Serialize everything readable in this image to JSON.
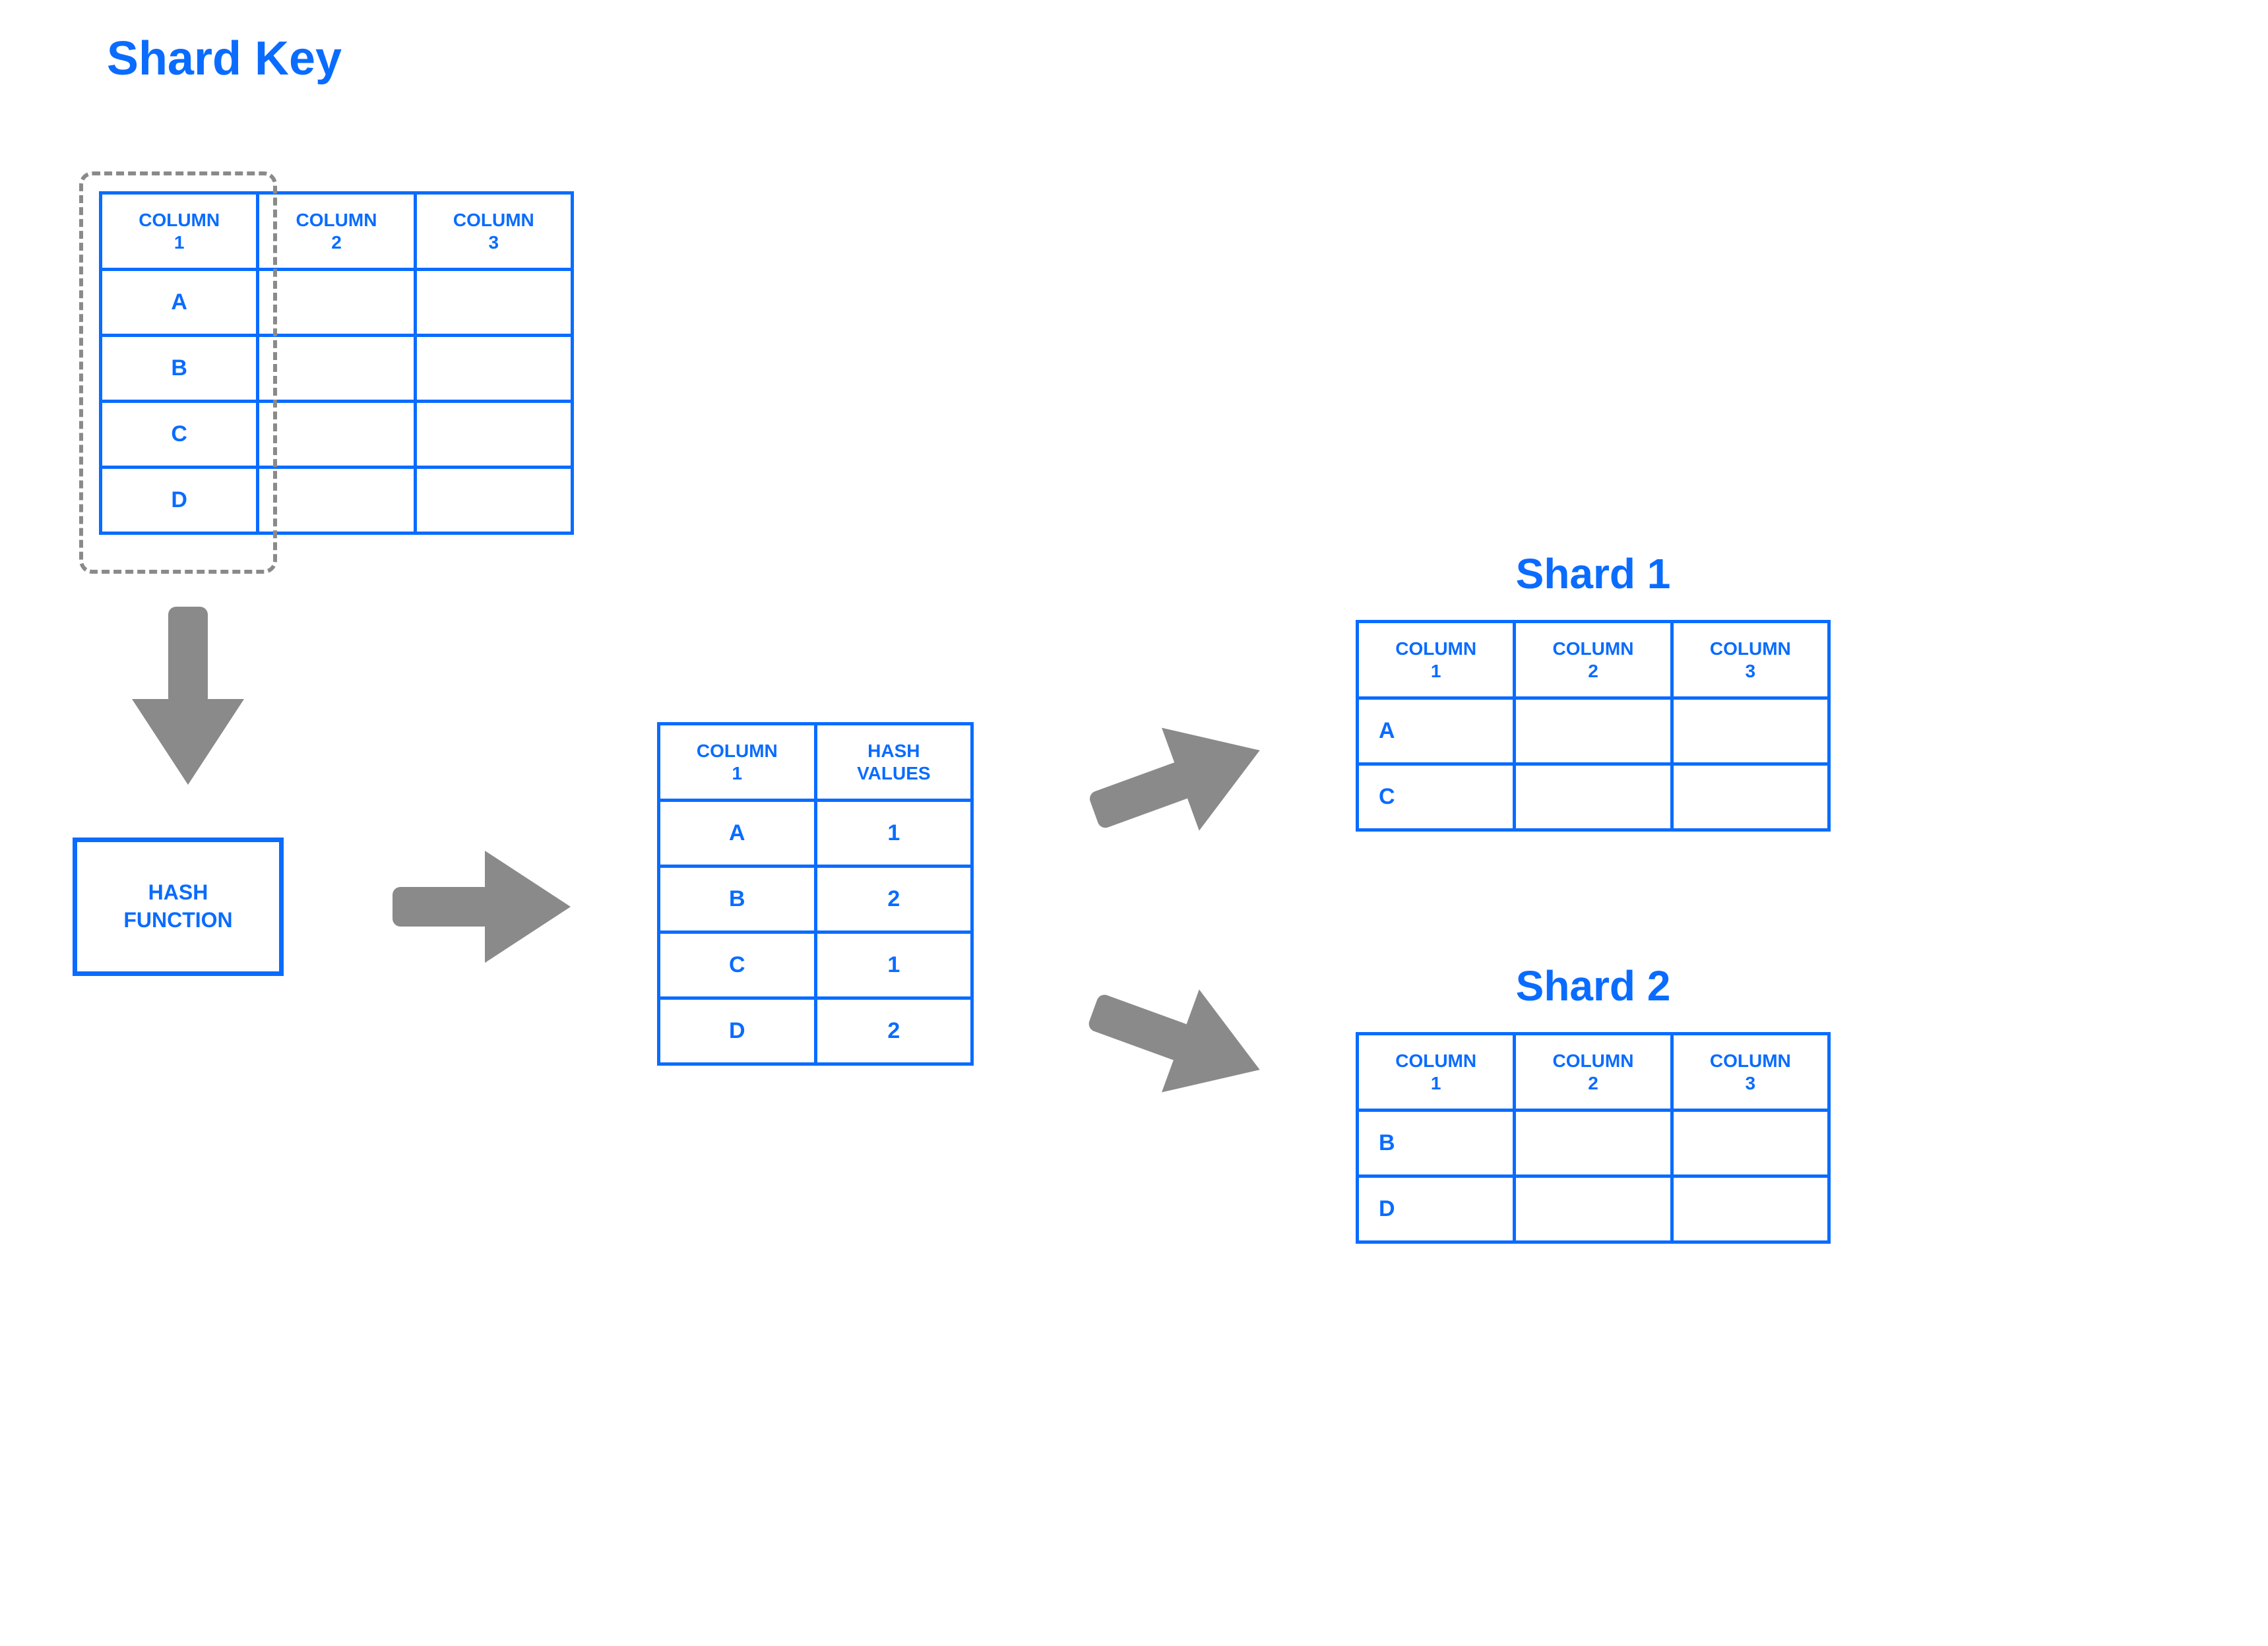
{
  "labels": {
    "shard_key": "Shard\nKey",
    "shard1": "Shard 1",
    "shard2": "Shard 2",
    "hash_function": "HASH\nFUNCTION"
  },
  "columns": {
    "c1": "COLUMN\n1",
    "c2": "COLUMN\n2",
    "c3": "COLUMN\n3",
    "hash_values": "HASH\nVALUES"
  },
  "source_table": {
    "rows": [
      "A",
      "B",
      "C",
      "D"
    ]
  },
  "hash_table": {
    "rows": [
      {
        "key": "A",
        "hash": "1"
      },
      {
        "key": "B",
        "hash": "2"
      },
      {
        "key": "C",
        "hash": "1"
      },
      {
        "key": "D",
        "hash": "2"
      }
    ]
  },
  "shard1_table": {
    "rows": [
      "A",
      "C"
    ]
  },
  "shard2_table": {
    "rows": [
      "B",
      "D"
    ]
  },
  "chart_data": {
    "type": "table",
    "description": "Hash-based database sharding diagram: a source table's shard key column is passed through a hash function producing hash values, which route rows to Shard 1 or Shard 2.",
    "source_table": {
      "columns": [
        "COLUMN 1",
        "COLUMN 2",
        "COLUMN 3"
      ],
      "shard_key_column": "COLUMN 1",
      "rows": [
        {
          "COLUMN 1": "A",
          "COLUMN 2": "",
          "COLUMN 3": ""
        },
        {
          "COLUMN 1": "B",
          "COLUMN 2": "",
          "COLUMN 3": ""
        },
        {
          "COLUMN 1": "C",
          "COLUMN 2": "",
          "COLUMN 3": ""
        },
        {
          "COLUMN 1": "D",
          "COLUMN 2": "",
          "COLUMN 3": ""
        }
      ]
    },
    "hash_function_output": {
      "columns": [
        "COLUMN 1",
        "HASH VALUES"
      ],
      "rows": [
        {
          "COLUMN 1": "A",
          "HASH VALUES": 1
        },
        {
          "COLUMN 1": "B",
          "HASH VALUES": 2
        },
        {
          "COLUMN 1": "C",
          "HASH VALUES": 1
        },
        {
          "COLUMN 1": "D",
          "HASH VALUES": 2
        }
      ]
    },
    "shards": [
      {
        "name": "Shard 1",
        "hash_value": 1,
        "columns": [
          "COLUMN 1",
          "COLUMN 2",
          "COLUMN 3"
        ],
        "rows": [
          {
            "COLUMN 1": "A",
            "COLUMN 2": "",
            "COLUMN 3": ""
          },
          {
            "COLUMN 1": "C",
            "COLUMN 2": "",
            "COLUMN 3": ""
          }
        ]
      },
      {
        "name": "Shard 2",
        "hash_value": 2,
        "columns": [
          "COLUMN 1",
          "COLUMN 2",
          "COLUMN 3"
        ],
        "rows": [
          {
            "COLUMN 1": "B",
            "COLUMN 2": "",
            "COLUMN 3": ""
          },
          {
            "COLUMN 1": "D",
            "COLUMN 2": "",
            "COLUMN 3": ""
          }
        ]
      }
    ]
  }
}
